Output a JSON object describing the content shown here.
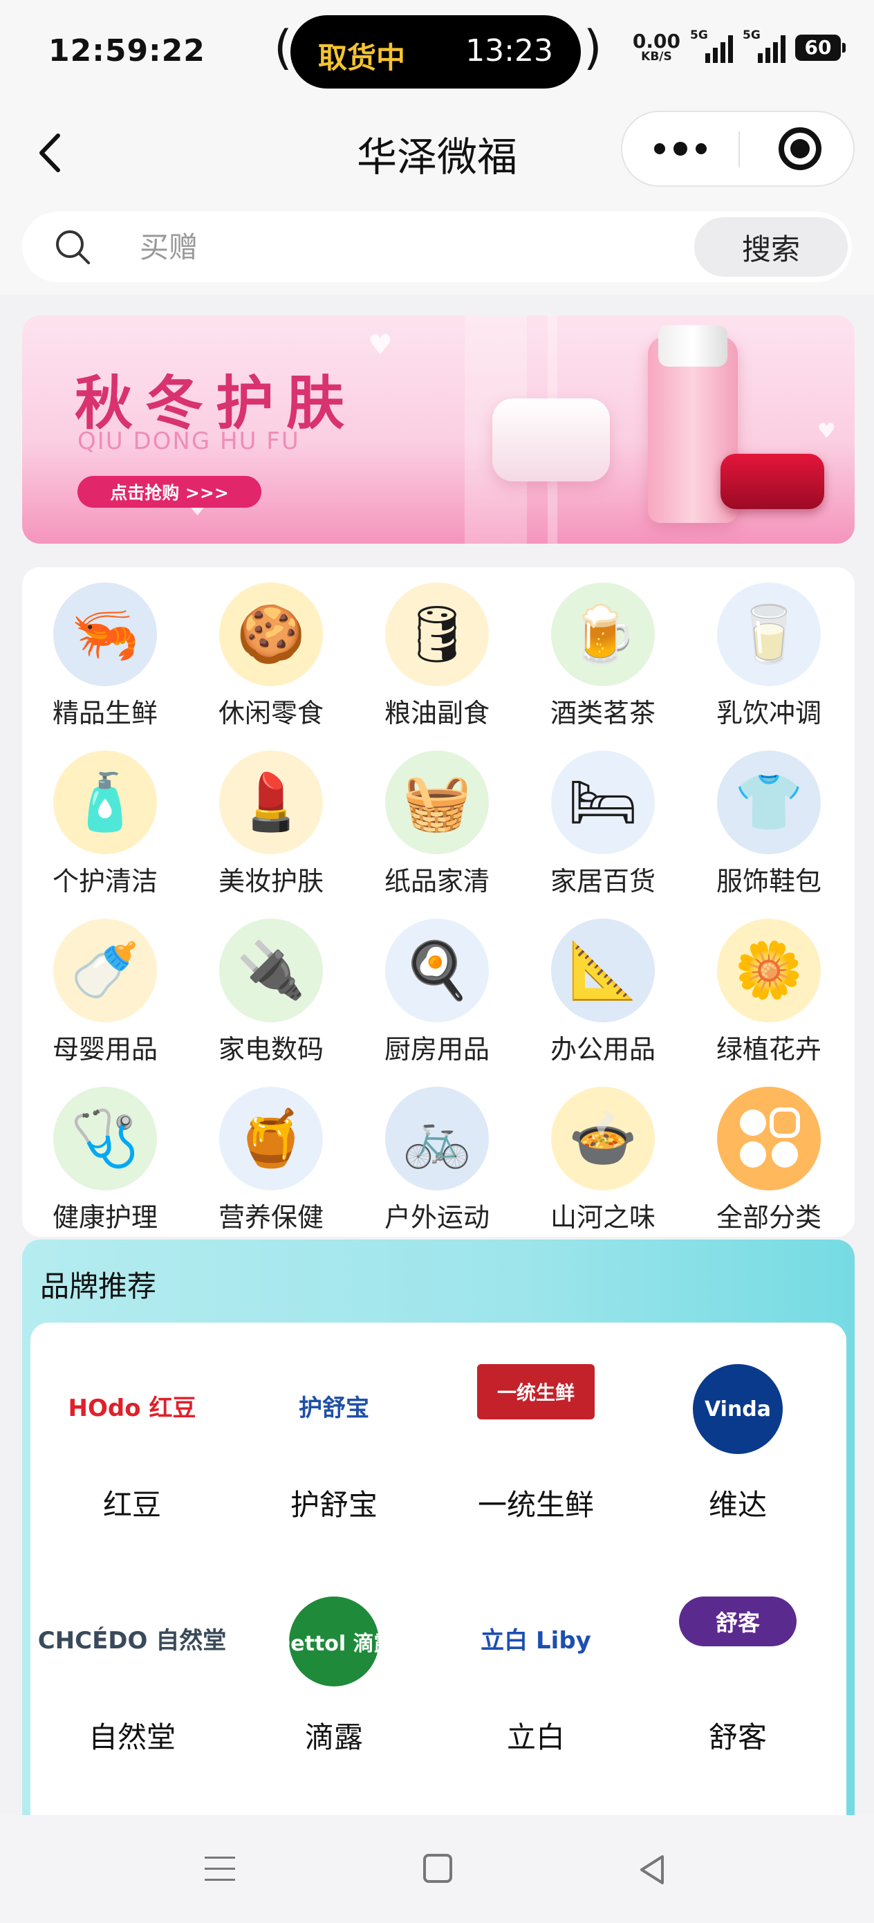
{
  "status_bar": {
    "time": "12:59:22",
    "island_left": "取货中",
    "island_right": "13:23",
    "net_speed": "0.00",
    "net_unit": "KB/S",
    "signal_tag": "5G",
    "battery": "60"
  },
  "nav": {
    "title": "华泽微福"
  },
  "search": {
    "placeholder": "买赠",
    "button": "搜索"
  },
  "banner": {
    "title": "秋冬护肤",
    "subtitle": "QIU DONG HU FU",
    "cta": "点击抢购 >>>"
  },
  "categories": [
    {
      "label": "精品生鲜",
      "icon": "seafood-icon"
    },
    {
      "label": "休闲零食",
      "icon": "snack-icon"
    },
    {
      "label": "粮油副食",
      "icon": "oil-icon"
    },
    {
      "label": "酒类茗茶",
      "icon": "drink-icon"
    },
    {
      "label": "乳饮冲调",
      "icon": "milk-icon"
    },
    {
      "label": "个护清洁",
      "icon": "soap-icon"
    },
    {
      "label": "美妆护肤",
      "icon": "cosmetic-icon"
    },
    {
      "label": "纸品家清",
      "icon": "detergent-icon"
    },
    {
      "label": "家居百货",
      "icon": "towel-icon"
    },
    {
      "label": "服饰鞋包",
      "icon": "shirt-icon"
    },
    {
      "label": "母婴用品",
      "icon": "baby-icon"
    },
    {
      "label": "家电数码",
      "icon": "appliance-icon"
    },
    {
      "label": "厨房用品",
      "icon": "kitchen-icon"
    },
    {
      "label": "办公用品",
      "icon": "stationery-icon"
    },
    {
      "label": "绿植花卉",
      "icon": "flower-icon"
    },
    {
      "label": "健康护理",
      "icon": "health-icon"
    },
    {
      "label": "营养保健",
      "icon": "honey-icon"
    },
    {
      "label": "户外运动",
      "icon": "bicycle-icon"
    },
    {
      "label": "山河之味",
      "icon": "soup-icon"
    },
    {
      "label": "全部分类",
      "icon": "all-categories-icon"
    }
  ],
  "brands": {
    "title": "品牌推荐",
    "items": [
      {
        "name": "红豆",
        "logo_text": "HOdo 红豆",
        "color": "#e0202a"
      },
      {
        "name": "护舒宝",
        "logo_text": "护舒宝",
        "color": "#1f4fa8"
      },
      {
        "name": "一统生鲜",
        "logo_text": "一统生鲜",
        "color": "#c4222b"
      },
      {
        "name": "维达",
        "logo_text": "Vinda",
        "color": "#0a3a8c"
      },
      {
        "name": "自然堂",
        "logo_text": "CHCÉDO 自然堂",
        "color": "#3a4a5a"
      },
      {
        "name": "滴露",
        "logo_text": "Dettol 滴露",
        "color": "#1f8a3a"
      },
      {
        "name": "立白",
        "logo_text": "立白 Liby",
        "color": "#1c4fb0"
      },
      {
        "name": "舒客",
        "logo_text": "舒客",
        "color": "#5b2a8e"
      }
    ]
  },
  "colors": {
    "banner_accent": "#d8336e",
    "brand_section_bg": "#9de5eb"
  }
}
